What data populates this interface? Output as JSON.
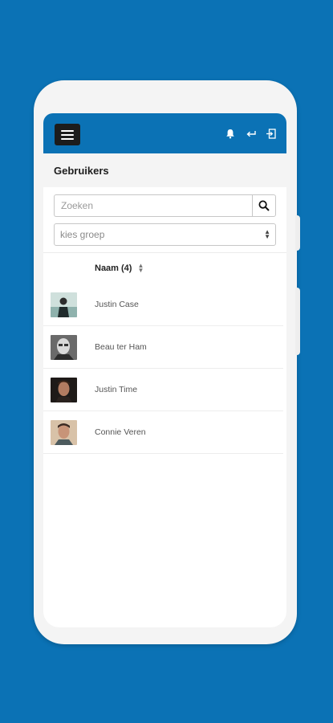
{
  "header": {
    "menu_icon": "hamburger-menu-icon",
    "icons": [
      "bell-icon",
      "back-arrow-icon",
      "logout-icon"
    ]
  },
  "page": {
    "title": "Gebruikers"
  },
  "search": {
    "placeholder": "Zoeken",
    "value": ""
  },
  "group_select": {
    "value": "kies groep"
  },
  "table": {
    "column_header": "Naam (4)",
    "rows": [
      {
        "name": "Justin Case"
      },
      {
        "name": "Beau ter Ham"
      },
      {
        "name": "Justin Time"
      },
      {
        "name": "Connie Veren"
      }
    ]
  },
  "colors": {
    "brand": "#0b72b5",
    "menu_button": "#1c1c1c"
  }
}
